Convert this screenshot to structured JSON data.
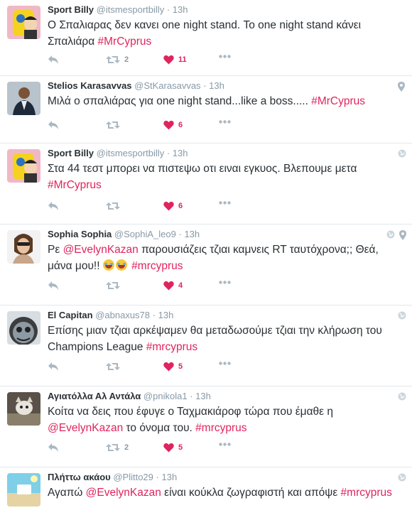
{
  "tweets": [
    {
      "name": "Sport Billy",
      "handle": "@itsmesportbilly",
      "time": "13h",
      "text_parts": [
        "Ο Σπαλιαρας δεν κανει one night stand. Το one night stand κάνει Σπαλιάρα ",
        "#MrCyprus"
      ],
      "retweets": "2",
      "likes": "11",
      "liked": true
    },
    {
      "name": "Stelios Karasavvas",
      "handle": "@StKarasavvas",
      "time": "13h",
      "text_parts": [
        "Μιλά ο σπαλιάρας για one night stand...like a boss..... ",
        "#MrCyprus"
      ],
      "retweets": "",
      "likes": "6",
      "liked": true
    },
    {
      "name": "Sport Billy",
      "handle": "@itsmesportbilly",
      "time": "13h",
      "text_parts": [
        "Στα 44 τεστ μπορει να πιστεψω οτι ειναι εγκυος. Βλεπουμε μετα ",
        "#MrCyprus"
      ],
      "retweets": "",
      "likes": "6",
      "liked": true
    },
    {
      "name": "Sophia Sophia",
      "handle": "@SophiA_leo9",
      "time": "13h",
      "text_parts": [
        "Ρε ",
        "@EvelynKazan",
        " παρουσιάζεις τζιαι καμνεις RT ταυτόχρονα;; Θεά, μάνα μου!! ",
        "#mrcyprus"
      ],
      "retweets": "",
      "likes": "4",
      "liked": true
    },
    {
      "name": "El Capitan",
      "handle": "@abnaxus78",
      "time": "13h",
      "text_parts": [
        "Επίσης μιαν τζιαι  αρκέψαμεν θα μεταδωσούμε τζιαι την κλήρωση του Champions League ",
        "#mrcyprus"
      ],
      "retweets": "",
      "likes": "5",
      "liked": true
    },
    {
      "name": "Αγιατόλλα Αλ Αντάλα",
      "handle": "@pnikola1",
      "time": "13h",
      "text_parts": [
        "Κοίτα να δεις που έφυγε ο Ταχμακιάροφ τώρα που έμαθε η ",
        "@EvelynKazan",
        " το όνομα του. ",
        "#mrcyprus"
      ],
      "retweets": "2",
      "likes": "5",
      "liked": true
    },
    {
      "name": "Πλήττω ακάου",
      "handle": "@Plitto29",
      "time": "13h",
      "text_parts": [
        "Αγαπώ ",
        "@EvelynKazan",
        "  είναι κούκλα ζωγραφιστή και απόψε ",
        "#mrcyprus"
      ],
      "retweets": "",
      "likes": "",
      "liked": false
    }
  ],
  "icons": {
    "reply": "reply-icon",
    "retweet": "retweet-icon",
    "like": "heart-icon",
    "more": "more-dots-icon",
    "location": "location-pin-icon",
    "globe": "globe-icon"
  },
  "colors": {
    "accent": "#e0245e",
    "muted": "#8899a6",
    "icon": "#aab8c2",
    "divider": "#e1e8ed"
  }
}
